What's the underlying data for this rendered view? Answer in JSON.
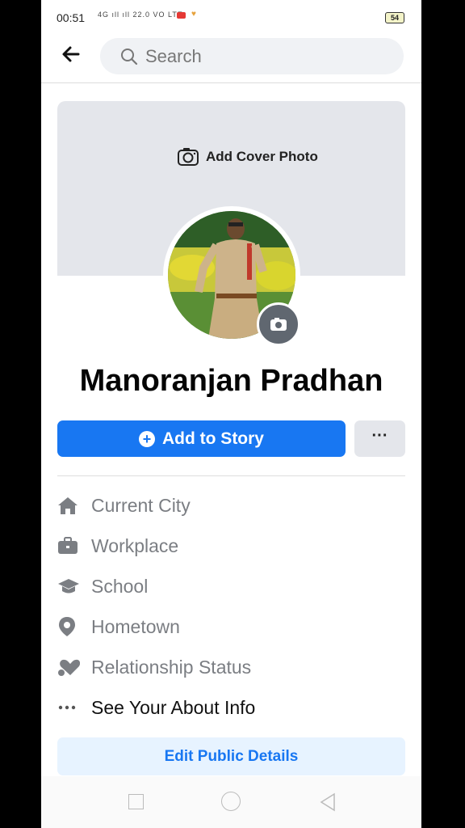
{
  "status_bar": {
    "time": "00:51",
    "signal_text": "4G ıll ıll 22.0 VO LTE",
    "battery": "54"
  },
  "top_nav": {
    "back_icon": "arrow-left-icon",
    "search_placeholder": "Search"
  },
  "cover": {
    "add_cover_label": "Add Cover Photo"
  },
  "profile": {
    "name": "Manoranjan Pradhan"
  },
  "actions": {
    "add_story_label": "Add to Story",
    "more_label": "···"
  },
  "details": [
    {
      "icon": "home-icon",
      "label": "Current City"
    },
    {
      "icon": "briefcase-icon",
      "label": "Workplace"
    },
    {
      "icon": "graduation-cap-icon",
      "label": "School"
    },
    {
      "icon": "location-pin-icon",
      "label": "Hometown"
    },
    {
      "icon": "heart-icon",
      "label": "Relationship Status"
    },
    {
      "icon": "ellipsis-icon",
      "label": "See Your About Info"
    }
  ],
  "edit_button_label": "Edit Public Details",
  "colors": {
    "accent": "#1877f2",
    "accent_light": "#e7f3ff",
    "cover_gray": "#e4e6eb"
  }
}
